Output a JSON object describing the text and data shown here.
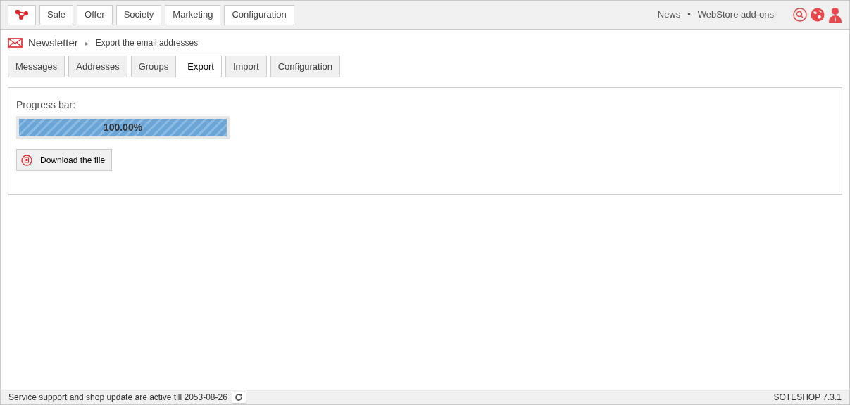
{
  "top_menu": [
    {
      "label": "Sale"
    },
    {
      "label": "Offer"
    },
    {
      "label": "Society"
    },
    {
      "label": "Marketing"
    },
    {
      "label": "Configuration"
    }
  ],
  "top_links": [
    "News",
    "•",
    "WebStore add-ons"
  ],
  "breadcrumb": {
    "section": "Newsletter",
    "separator": "▸",
    "page": "Export the email addresses"
  },
  "tabs": [
    {
      "label": "Messages",
      "selected": false
    },
    {
      "label": "Addresses",
      "selected": false
    },
    {
      "label": "Groups",
      "selected": false
    },
    {
      "label": "Export",
      "selected": true
    },
    {
      "label": "Import",
      "selected": false
    },
    {
      "label": "Configuration",
      "selected": false
    }
  ],
  "progress": {
    "label": "Progress bar:",
    "level": 1,
    "reading": "100.00%"
  },
  "download_button": "Download the file",
  "status_bar": {
    "text": "Service support and shop update are active till 2053-08-26",
    "version": "SOTESHOP 7.3.1"
  }
}
